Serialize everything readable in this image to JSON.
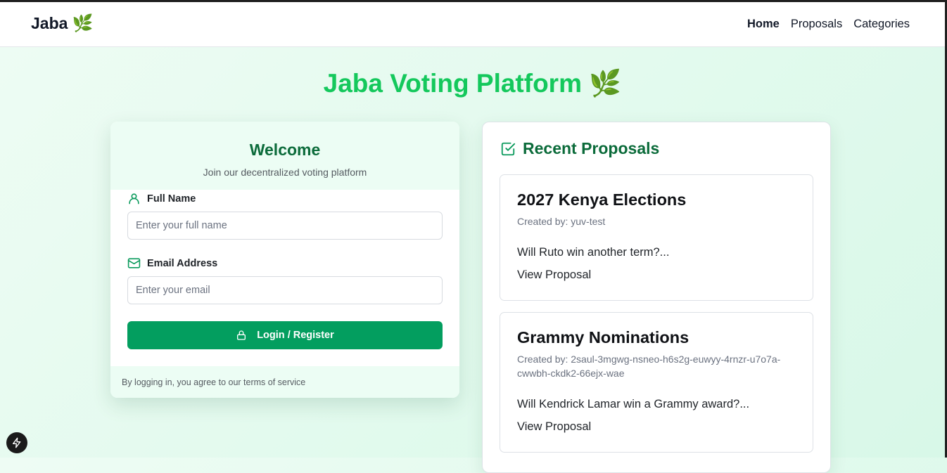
{
  "nav": {
    "brand": "Jaba",
    "brand_icon": "🌿",
    "links": [
      {
        "label": "Home",
        "active": true
      },
      {
        "label": "Proposals",
        "active": false
      },
      {
        "label": "Categories",
        "active": false
      }
    ]
  },
  "hero": {
    "title": "Jaba Voting Platform 🌿"
  },
  "login": {
    "title": "Welcome",
    "subtitle": "Join our decentralized voting platform",
    "name_label": "Full Name",
    "name_placeholder": "Enter your full name",
    "email_label": "Email Address",
    "email_placeholder": "Enter your email",
    "button_label": "Login / Register",
    "footer_text": "By logging in, you agree to our terms of service"
  },
  "proposals": {
    "title": "Recent Proposals",
    "items": [
      {
        "title": "2027 Kenya Elections",
        "created_by": "Created by: yuv-test",
        "description": "Will Ruto win another term?...",
        "link": "View Proposal"
      },
      {
        "title": "Grammy Nominations",
        "created_by": "Created by: 2saul-3mgwg-nsneo-h6s2g-euwyy-4rnzr-u7o7a-cwwbh-ckdk2-66ejx-wae",
        "description": "Will Kendrick Lamar win a Grammy award?...",
        "link": "View Proposal"
      }
    ]
  },
  "colors": {
    "accent": "#14c85c",
    "button": "#039e5f",
    "heading_green": "#0b6b3a"
  }
}
